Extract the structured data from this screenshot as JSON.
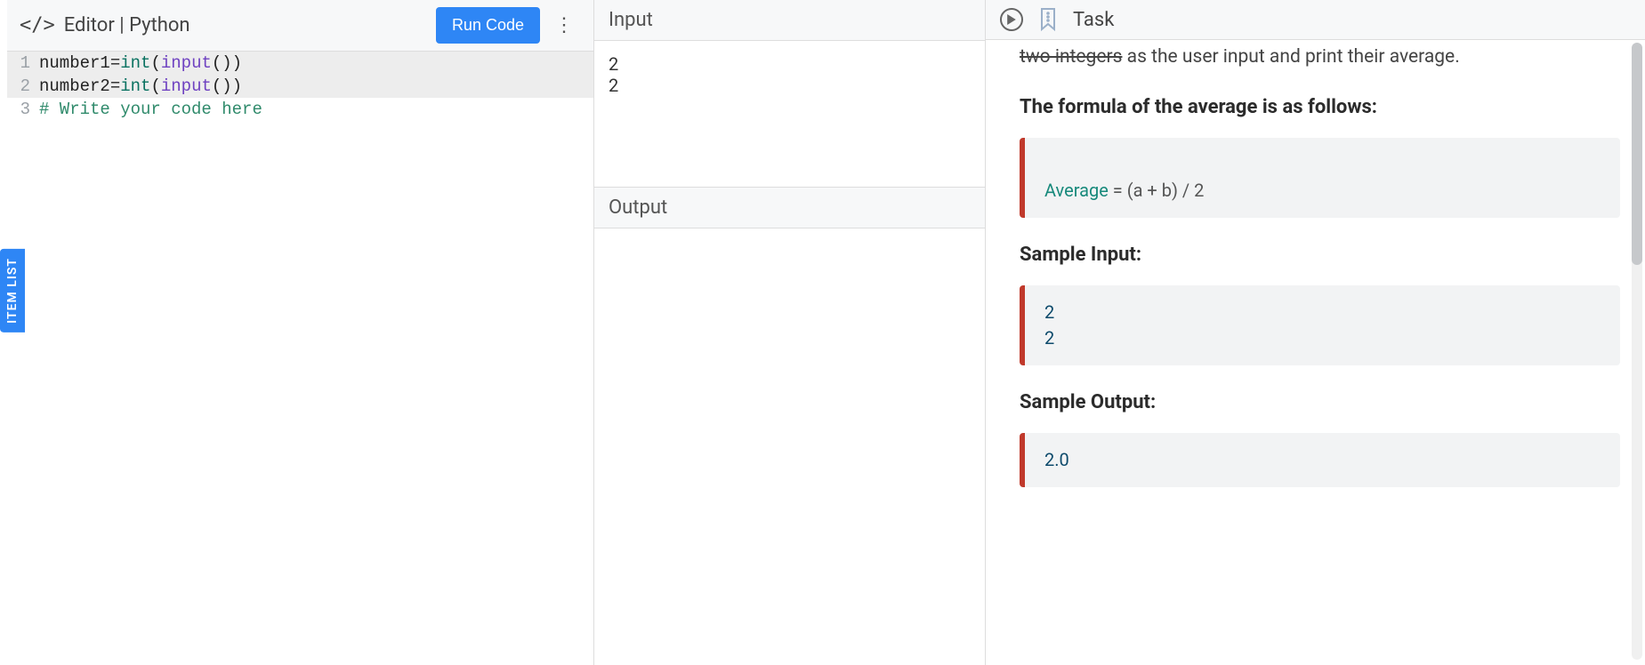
{
  "left_rail": {
    "item_list_label": "ITEM LIST"
  },
  "editor": {
    "title_prefix": "Editor",
    "title_sep": " | ",
    "language": "Python",
    "run_label": "Run Code",
    "lines": [
      {
        "n": "1",
        "var": "number1",
        "op": "=",
        "kw": "int",
        "fn": "input",
        "tail": "())",
        "hl": true
      },
      {
        "n": "2",
        "var": "number2",
        "op": "=",
        "kw": "int",
        "fn": "input",
        "tail": "())",
        "hl": true
      },
      {
        "n": "3",
        "comment": "# Write your code here",
        "hl": false
      }
    ]
  },
  "io": {
    "input_label": "Input",
    "input_text": "2\n2",
    "output_label": "Output",
    "output_text": ""
  },
  "task": {
    "header_label": "Task",
    "partial_top_struck": "two integers",
    "partial_top_rest": " as the user input and print their average.",
    "formula_heading": "The formula of the average is as follows:",
    "formula_avg": "Average",
    "formula_rest": " = (a + b) / 2",
    "sample_input_heading": "Sample Input:",
    "sample_input": "2\n2",
    "sample_output_heading": "Sample Output:",
    "sample_output": "2.0"
  }
}
